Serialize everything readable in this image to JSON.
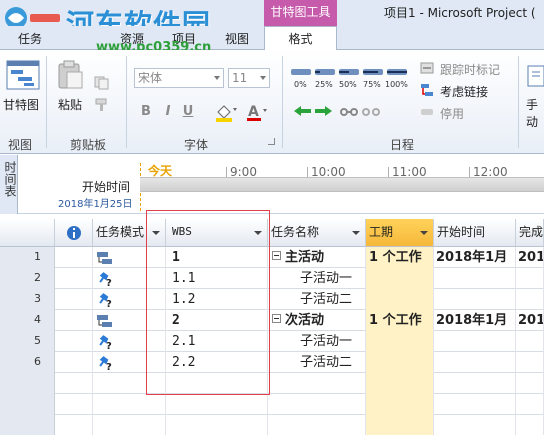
{
  "window": {
    "title": "项目1 - Microsoft Project (",
    "context_group": "甘特图工具"
  },
  "watermark": {
    "title": "河东软件园",
    "url": "www.pc0359.cn"
  },
  "tabs": {
    "task": "任务",
    "resource": "资源",
    "project": "项目",
    "view": "视图",
    "format": "格式"
  },
  "ribbon": {
    "groups": {
      "view": "视图",
      "clipboard": "剪贴板",
      "font": "字体",
      "schedule": "日程"
    },
    "gantt_chart_label": "甘特图",
    "paste_label": "粘贴",
    "font_name": "宋体",
    "font_size": "11",
    "percent_buttons": [
      "0%",
      "25%",
      "50%",
      "75%",
      "100%"
    ],
    "respect_links": "跟踪时标记",
    "check_links": "考虑链接",
    "inactivate": "停用",
    "manual_schedule": "手动"
  },
  "timeline": {
    "tab_label": "时间表",
    "today": "今天",
    "start_label": "开始时间",
    "start_date": "2018年1月25日",
    "ticks": [
      "9:00",
      "10:00",
      "11:00",
      "12:00"
    ]
  },
  "grid": {
    "headers": {
      "mode": "任务模式",
      "wbs": "WBS",
      "name": "任务名称",
      "duration": "工期",
      "start": "开始时间",
      "finish": "完成"
    },
    "rows": [
      {
        "id": "1",
        "mode": "auto",
        "wbs": "1",
        "name": "主活动",
        "summary": true,
        "duration": "1 个工作",
        "start": "2018年1月",
        "finish": "201"
      },
      {
        "id": "2",
        "mode": "manual",
        "wbs": "1.1",
        "name": "子活动一",
        "summary": false,
        "duration": "",
        "start": "",
        "finish": ""
      },
      {
        "id": "3",
        "mode": "manual",
        "wbs": "1.2",
        "name": "子活动二",
        "summary": false,
        "duration": "",
        "start": "",
        "finish": ""
      },
      {
        "id": "4",
        "mode": "auto",
        "wbs": "2",
        "name": "次活动",
        "summary": true,
        "duration": "1 个工作",
        "start": "2018年1月",
        "finish": "201"
      },
      {
        "id": "5",
        "mode": "manual",
        "wbs": "2.1",
        "name": "子活动一",
        "summary": false,
        "duration": "",
        "start": "",
        "finish": ""
      },
      {
        "id": "6",
        "mode": "manual",
        "wbs": "2.2",
        "name": "子活动二",
        "summary": false,
        "duration": "",
        "start": "",
        "finish": ""
      }
    ]
  },
  "colors": {
    "accent": "#2b8fd6",
    "context_tab": "#c65aab",
    "today": "#e8a200",
    "duration_col": "#fff2c6",
    "highlight": "#e0404a"
  }
}
